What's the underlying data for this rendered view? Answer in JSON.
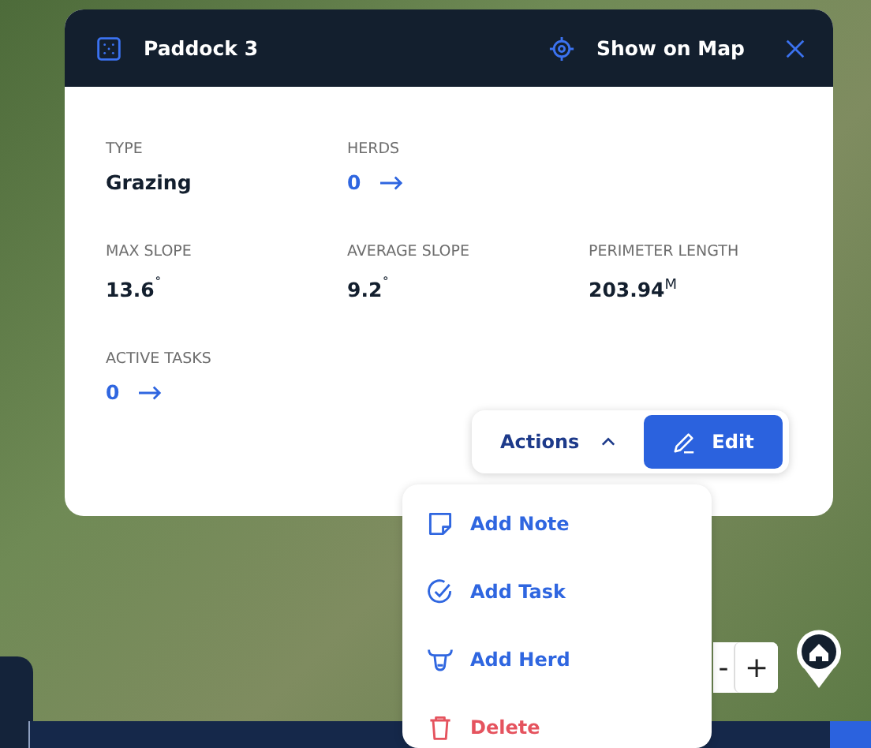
{
  "panel": {
    "title": "Paddock 3",
    "show_on_map": "Show on Map",
    "rows": [
      [
        {
          "label": "TYPE",
          "value": "Grazing",
          "kind": "text"
        },
        {
          "label": "HERDS",
          "value": "0",
          "kind": "link"
        }
      ],
      [
        {
          "label": "MAX SLOPE",
          "value": "13.6$^{˚}$",
          "kind": "text"
        },
        {
          "label": "AVERAGE SLOPE",
          "value": "9.2$^{˚}$",
          "kind": "text"
        },
        {
          "label": "PERIMETER LENGTH",
          "value": "203.94$^{M}$",
          "kind": "text"
        }
      ],
      [
        {
          "label": "ACTIVE TASKS",
          "value": "0",
          "kind": "link"
        }
      ]
    ],
    "actions": {
      "label": "Actions",
      "expanded": true
    },
    "edit_button": "Edit"
  },
  "menu": [
    {
      "label": "Add Note",
      "kind": "note"
    },
    {
      "label": "Add Task",
      "kind": "task"
    },
    {
      "label": "Add Herd",
      "kind": "herd"
    },
    {
      "label": "Delete",
      "kind": "delete"
    }
  ],
  "zoom_controls": [
    "-",
    "+"
  ]
}
